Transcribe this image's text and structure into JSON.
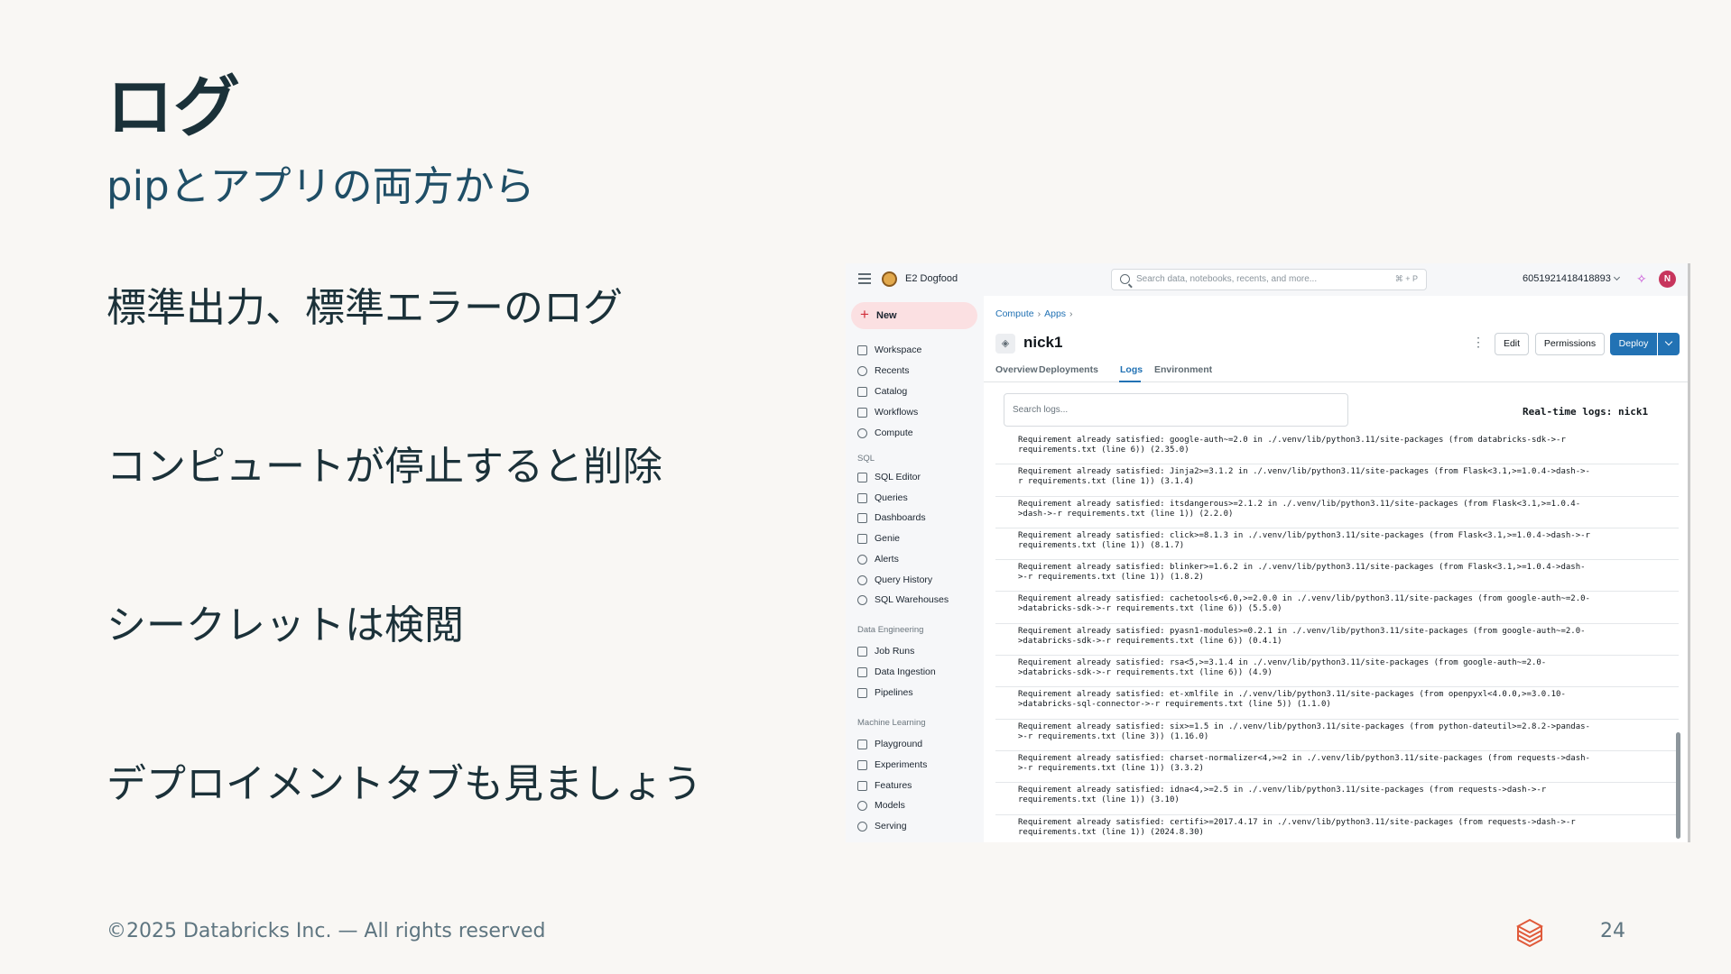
{
  "slide": {
    "title": "ログ",
    "subtitle": "pipとアプリの両方から",
    "bullets": [
      "標準出力、標準エラーのログ",
      "コンピュートが停止すると削除",
      "シークレットは検閲",
      "デプロイメントタブも見ましょう"
    ],
    "footer": "©2025 Databricks Inc. — All rights reserved",
    "page_number": "24"
  },
  "screenshot": {
    "topbar": {
      "workspace": "E2 Dogfood",
      "search_placeholder": "Search data, notebooks, recents, and more...",
      "search_shortcut": "⌘ + P",
      "account_id": "6051921418418893",
      "avatar_initial": "N"
    },
    "sidebar": {
      "new_label": "New",
      "items": [
        "Workspace",
        "Recents",
        "Catalog",
        "Workflows",
        "Compute"
      ],
      "sql_section": "SQL",
      "sql_items": [
        "SQL Editor",
        "Queries",
        "Dashboards",
        "Genie",
        "Alerts",
        "Query History",
        "SQL Warehouses"
      ],
      "de_section": "Data Engineering",
      "de_items": [
        "Job Runs",
        "Data Ingestion",
        "Pipelines"
      ],
      "ml_section": "Machine Learning",
      "ml_items": [
        "Playground",
        "Experiments",
        "Features",
        "Models",
        "Serving"
      ]
    },
    "main": {
      "breadcrumb": [
        "Compute",
        "Apps"
      ],
      "app_name": "nick1",
      "buttons": {
        "edit": "Edit",
        "permissions": "Permissions",
        "deploy": "Deploy"
      },
      "tabs": [
        "Overview",
        "Deployments",
        "Logs",
        "Environment"
      ],
      "active_tab": "Logs",
      "log_search_placeholder": "Search logs...",
      "realtime_title": "Real-time logs: nick1",
      "logs": [
        "Requirement already satisfied: google-auth~=2.0 in ./.venv/lib/python3.11/site-packages (from databricks-sdk->-r\nrequirements.txt (line 6)) (2.35.0)",
        "Requirement already satisfied: Jinja2>=3.1.2 in ./.venv/lib/python3.11/site-packages (from Flask<3.1,>=1.0.4->dash->-\nr requirements.txt (line 1)) (3.1.4)",
        "Requirement already satisfied: itsdangerous>=2.1.2 in ./.venv/lib/python3.11/site-packages (from Flask<3.1,>=1.0.4-\n>dash->-r requirements.txt (line 1)) (2.2.0)",
        "Requirement already satisfied: click>=8.1.3 in ./.venv/lib/python3.11/site-packages (from Flask<3.1,>=1.0.4->dash->-r\nrequirements.txt (line 1)) (8.1.7)",
        "Requirement already satisfied: blinker>=1.6.2 in ./.venv/lib/python3.11/site-packages (from Flask<3.1,>=1.0.4->dash-\n>-r requirements.txt (line 1)) (1.8.2)",
        "Requirement already satisfied: cachetools<6.0,>=2.0.0 in ./.venv/lib/python3.11/site-packages (from google-auth~=2.0-\n>databricks-sdk->-r requirements.txt (line 6)) (5.5.0)",
        "Requirement already satisfied: pyasn1-modules>=0.2.1 in ./.venv/lib/python3.11/site-packages (from google-auth~=2.0-\n>databricks-sdk->-r requirements.txt (line 6)) (0.4.1)",
        "Requirement already satisfied: rsa<5,>=3.1.4 in ./.venv/lib/python3.11/site-packages (from google-auth~=2.0-\n>databricks-sdk->-r requirements.txt (line 6)) (4.9)",
        "Requirement already satisfied: et-xmlfile in ./.venv/lib/python3.11/site-packages (from openpyxl<4.0.0,>=3.0.10-\n>databricks-sql-connector->-r requirements.txt (line 5)) (1.1.0)",
        "Requirement already satisfied: six>=1.5 in ./.venv/lib/python3.11/site-packages (from python-dateutil>=2.8.2->pandas-\n>-r requirements.txt (line 3)) (1.16.0)",
        "Requirement already satisfied: charset-normalizer<4,>=2 in ./.venv/lib/python3.11/site-packages (from requests->dash-\n>-r requirements.txt (line 1)) (3.3.2)",
        "Requirement already satisfied: idna<4,>=2.5 in ./.venv/lib/python3.11/site-packages (from requests->dash->-r\nrequirements.txt (line 1)) (3.10)",
        "Requirement already satisfied: certifi>=2017.4.17 in ./.venv/lib/python3.11/site-packages (from requests->dash->-r\nrequirements.txt (line 1)) (2024.8.30)"
      ]
    }
  }
}
